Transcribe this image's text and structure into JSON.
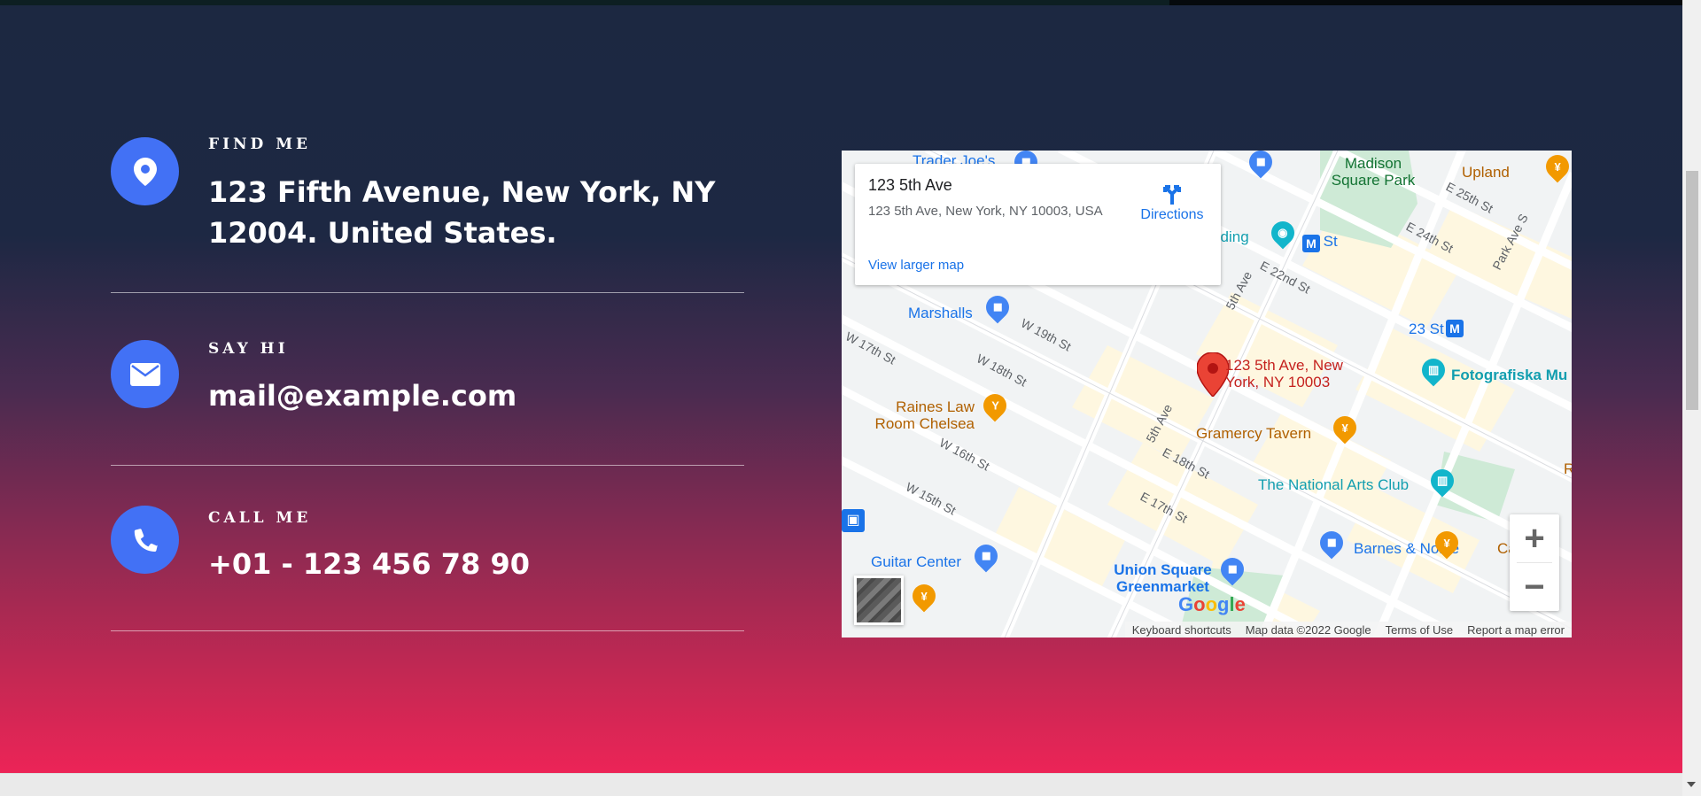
{
  "contact": {
    "find_me": {
      "label": "FIND ME",
      "value": "123 Fifth Avenue, New York, NY 12004. United States."
    },
    "say_hi": {
      "label": "SAY HI",
      "value": "mail@example.com"
    },
    "call_me": {
      "label": "CALL ME",
      "value": "+01 - 123 456 78 90"
    }
  },
  "map": {
    "card": {
      "title": "123 5th Ave",
      "address": "123 5th Ave, New York, NY 10003, USA",
      "view_larger": "View larger map",
      "directions": "Directions"
    },
    "marker_label": "123 5th Ave, New York, NY 10003",
    "labels": {
      "trader_joes": "Trader Joe's",
      "madison_square_park": "Madison Square Park",
      "upland": "Upland",
      "e25": "E 25th St",
      "e24": "E 24th St",
      "park_ave_s": "Park Ave S",
      "building": "ilding",
      "m23": "23 St",
      "e22": "E 22nd St",
      "fifth_ave_top": "5th Ave",
      "marshalls": "Marshalls",
      "w19": "W 19th St",
      "w17": "W 17th St",
      "w18": "W 18th St",
      "m23b": "23 St",
      "fotografiska": "Fotografiska Mu",
      "raines": "Raines Law Room Chelsea",
      "fifth_ave_mid": "5th Ave",
      "gramercy": "Gramercy Tavern",
      "w16": "W 16th St",
      "e18": "E 18th St",
      "national_arts": "The National Arts Club",
      "w15": "W 15th St",
      "e17": "E 17th St",
      "guitar_center": "Guitar Center",
      "barnes": "Barnes & Noble",
      "caffe": "Caffè Pa",
      "union_square": "Union Square Greenmarket",
      "r_edge": "R"
    },
    "attribution": {
      "shortcuts": "Keyboard shortcuts",
      "mapdata": "Map data ©2022 Google",
      "terms": "Terms of Use",
      "report": "Report a map error"
    },
    "logo": "Google",
    "colors": {
      "road": "#ffffff",
      "block": "#f1f3f4",
      "land": "#fef7e0",
      "park": "#ceead6",
      "marker": "#ea4335",
      "blue_poi": "#4285f4",
      "orange_poi": "#f29900",
      "teal_poi": "#12b5cb"
    }
  },
  "colors": {
    "icon_circle": "#4271f5",
    "gradient_top": "#1c2841",
    "gradient_bottom": "#ec2457"
  }
}
